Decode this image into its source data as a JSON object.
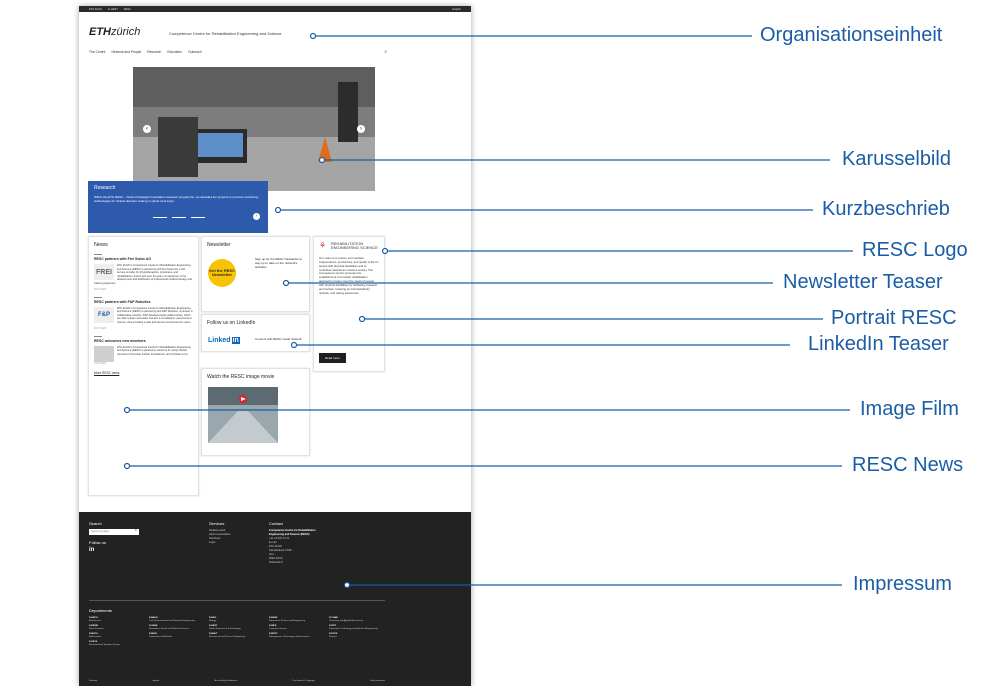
{
  "topbar": {
    "crumbs": [
      "ETH Zürich",
      "D-HEST",
      "RESC"
    ],
    "language": "English"
  },
  "header": {
    "logo_bold": "ETH",
    "logo_rest": "zürich",
    "unit": "Competence Centre for Rehabilitation Engineering and Science"
  },
  "nav": [
    "The Centre",
    "Network and People",
    "Research",
    "Education",
    "Outreach"
  ],
  "teaser": {
    "title": "Research",
    "text": "Within the ETH RESC – Swiss Paraplegic Foundation research programme, we awarded ten projects to promote monitoring technologies for clinical decision making in spinal cord injury."
  },
  "news": {
    "title": "News",
    "items": [
      {
        "title": "RESC partners with Frei Swiss AG",
        "thumb": "FREI",
        "body": "ETH Zürich's Competence Centre for Rehabilitation Engineering and Science (RESC) is partnering with Frei Swiss AG a full-service provider for physiotherapists, physicians, and rehabilitation centres with over 40 years of experience in the development and distribution of professional medical therapy and training equipment.",
        "date": "26.07.2023"
      },
      {
        "title": "RESC partners with F&P Robotics",
        "thumb": "F&P",
        "body": "ETH Zürich's Competence Centre for Rehabilitation Engineering and Science (RESC) is partnering with F&P Robotics, a pioneer in collaborative robotics. F&P develops highly-skilled robots, which are able to learn and assist humans in an adaptive, personal and manner, thus providing a safe and secure environment for users.",
        "date": "26.07.2023"
      },
      {
        "title": "RESC welcomes new members",
        "thumb": "",
        "body": "ETH Zürich's Competence Centre for Rehabilitation Engineering and Science (RESC) is pleased to welcome its newly elected members Chris Awai, Florian Frotzbahner, and Christian Lenz.",
        "date": "14.07.2023"
      }
    ],
    "more": "More RESC news"
  },
  "newsletter": {
    "title": "Newsletter",
    "badge": "Get the RESC Newsletter",
    "text": "Sign up for the RESC Newsletter to stay up to date on the network's activities"
  },
  "linkedin": {
    "title": "Follow us on LinkedIn",
    "logo": "Linked",
    "logo_in": "in",
    "text": "Connect with RESC social network"
  },
  "movie": {
    "title": "Watch the RESC image movie"
  },
  "portrait": {
    "logo": "REHABILITATION ENGINEERING SCIENCE",
    "text": "Our vision is to restore and maintain independence, productivity, and quality of life for people with physical disabilities and to contribute towards an inclusive society. The Competence Centre promotes the establishment of a holistic rehabilitation approach to better meet the needs of people with physical disabilities by facilitating research and transfer, fostering an interdisciplinary network, and raising awareness.",
    "button": "Read more"
  },
  "footer": {
    "search_title": "Search",
    "search_placeholder": "Search on pages",
    "follow": "Follow us",
    "social": "in",
    "services_title": "Services",
    "services": [
      "Student portal",
      "Alumni association",
      "ServDesk",
      "Login"
    ],
    "contact_title": "Contact",
    "contact_name": "Competence Centre for Rehabilitation Engineering and Science (RESC)",
    "contact_lines": [
      "+41 44 633 72 21",
      "E-mail",
      "ETH Zürich",
      "Gloriastrasse 37/39",
      "GLC",
      "8092 Zürich",
      "Switzerland"
    ],
    "departments_title": "Departments",
    "departments": [
      {
        "code": "D-ARCH",
        "name": "Architecture"
      },
      {
        "code": "D-BAUG",
        "name": "Civil, Environmental and Geomatic Engineering"
      },
      {
        "code": "D-BIOL",
        "name": "Biology"
      },
      {
        "code": "D-BSSE",
        "name": "Biosystems Science and Engineering"
      },
      {
        "code": "D-CHAB",
        "name": "Chemistry and Applied Biosciences"
      },
      {
        "code": "D-ERDW",
        "name": "Earth Sciences"
      },
      {
        "code": "D-GESS",
        "name": "Humanities, Social and Political Sciences"
      },
      {
        "code": "D-HEST",
        "name": "Health Sciences and Technology"
      },
      {
        "code": "D-INFK",
        "name": "Computer Science"
      },
      {
        "code": "D-ITET",
        "name": "Information Technology and Electrical Engineering"
      },
      {
        "code": "D-MATH",
        "name": "Mathematics"
      },
      {
        "code": "D-MATL",
        "name": "Department of Materials"
      },
      {
        "code": "D-MAVT",
        "name": "Mechanical and Process Engineering"
      },
      {
        "code": "D-MTEC",
        "name": "Management, Technology and Economics"
      },
      {
        "code": "D-PHYS",
        "name": "Physics"
      },
      {
        "code": "D-USYS",
        "name": "Environmental Systems Science"
      }
    ],
    "bottom": [
      "Sitemap",
      "Imprint",
      "Accessibility Statement",
      "Disclaimer & Copyright",
      "Data protection"
    ]
  },
  "callouts": [
    "Organisationseinheit",
    "Karusselbild",
    "Kurzbeschrieb",
    "RESC Logo",
    "Newsletter Teaser",
    "Portrait RESC",
    "LinkedIn Teaser",
    "Image Film",
    "RESC News",
    "Impressum"
  ],
  "colors": {
    "accent": "#2e5aab",
    "callout": "#1a5da6",
    "footer": "#222222",
    "badge": "#f6c400"
  }
}
